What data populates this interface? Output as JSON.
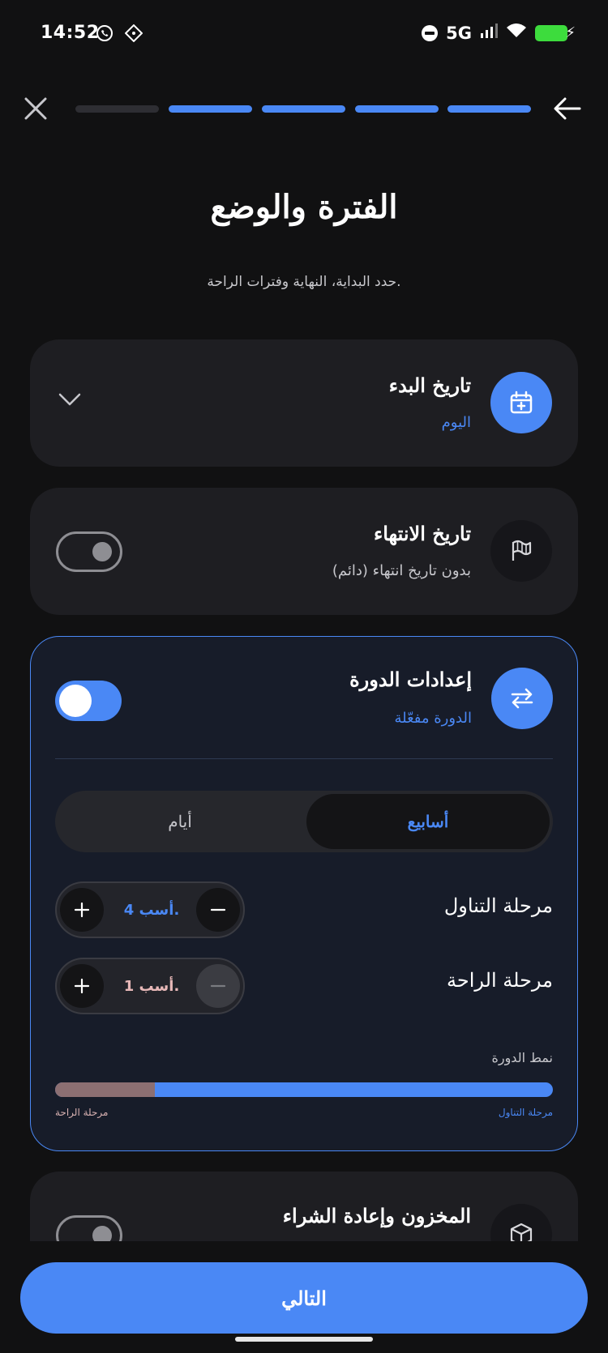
{
  "status_bar": {
    "time": "14:52",
    "network": "5G",
    "icons": [
      "whatsapp-icon",
      "app-icon",
      "do-not-disturb-icon",
      "signal-icon",
      "wifi-icon",
      "battery-charging-icon"
    ]
  },
  "nav": {
    "close_icon": "close-icon",
    "back_icon": "arrow-left-icon",
    "progress": {
      "total_steps": 5,
      "completed_steps": 4
    }
  },
  "header": {
    "title": "الفترة والوضع",
    "subtitle": "حدد البداية، النهاية وفترات الراحة."
  },
  "start_date": {
    "title": "تاريخ البدء",
    "value": "اليوم",
    "icon": "calendar-plus-icon"
  },
  "end_date": {
    "title": "تاريخ الانتهاء",
    "value": "بدون تاريخ انتهاء (دائم)",
    "icon": "flag-icon",
    "enabled": false
  },
  "cycle": {
    "title": "إعدادات الدورة",
    "status": "الدورة مفعّلة",
    "icon": "swap-arrows-icon",
    "enabled": true,
    "unit_options": [
      "أسابيع",
      "أيام"
    ],
    "selected_unit": "أسابيع",
    "on_phase": {
      "label": "مرحلة التناول",
      "value": "4 أسب."
    },
    "off_phase": {
      "label": "مرحلة الراحة",
      "value": "1 أسب."
    },
    "pattern": {
      "label": "نمط الدورة",
      "on_legend": "مرحلة التناول",
      "off_legend": "مرحلة الراحة",
      "off_fraction": 0.2
    }
  },
  "inventory": {
    "title": "المخزون وإعادة الشراء",
    "icon": "box-icon",
    "enabled": false
  },
  "footer": {
    "next_label": "التالي"
  },
  "colors": {
    "accent": "#4a88f5",
    "background": "#111112",
    "card": "#1e1e22",
    "rest_phase": "#8c6f72",
    "battery": "#3ddc3d"
  }
}
